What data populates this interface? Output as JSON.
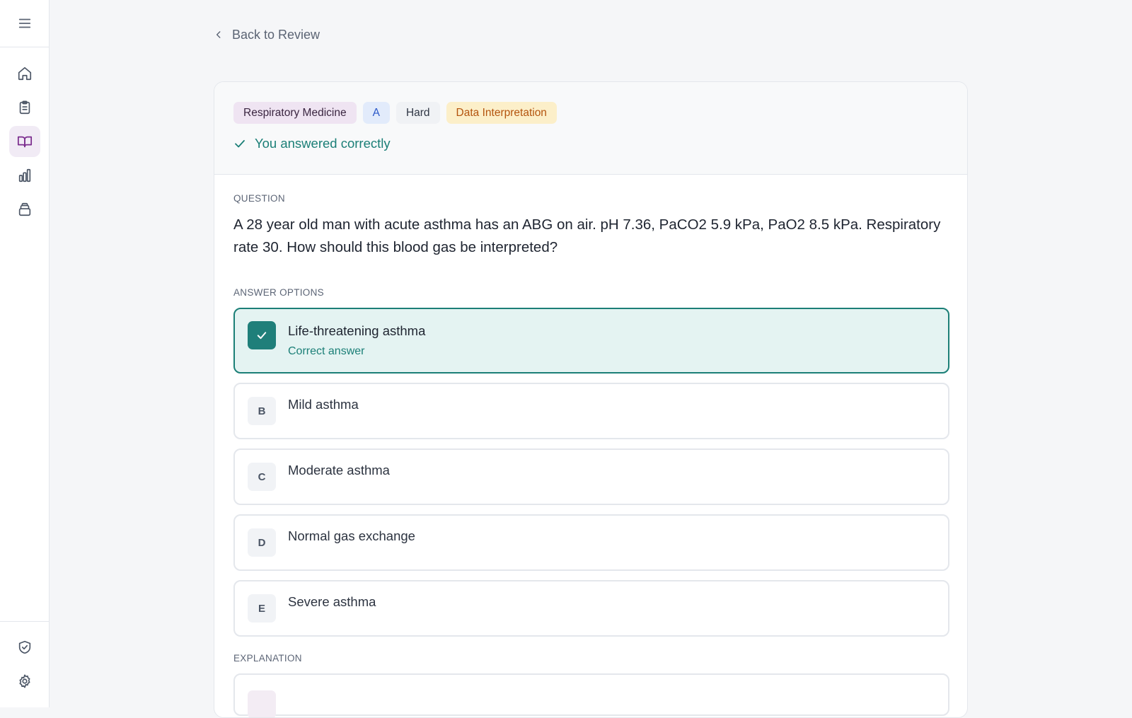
{
  "nav": {
    "back_label": "Back to Review"
  },
  "tags": {
    "specialty": "Respiratory Medicine",
    "answer_letter": "A",
    "difficulty": "Hard",
    "question_type": "Data Interpretation"
  },
  "status": {
    "text": "You answered correctly"
  },
  "question": {
    "label": "QUESTION",
    "text": "A 28 year old man with acute asthma has an ABG on air. pH 7.36, PaCO2 5.9 kPa, PaO2 8.5 kPa. Respiratory rate 30. How should this blood gas be interpreted?"
  },
  "answers": {
    "label": "ANSWER OPTIONS",
    "options": [
      {
        "letter": "A",
        "text": "Life-threatening asthma",
        "sub": "Correct answer"
      },
      {
        "letter": "B",
        "text": "Mild asthma"
      },
      {
        "letter": "C",
        "text": "Moderate asthma"
      },
      {
        "letter": "D",
        "text": "Normal gas exchange"
      },
      {
        "letter": "E",
        "text": "Severe asthma"
      }
    ]
  },
  "explanation": {
    "label": "EXPLANATION"
  },
  "colors": {
    "accent": "#1b7f77",
    "active_nav": "#7b2d8e"
  }
}
